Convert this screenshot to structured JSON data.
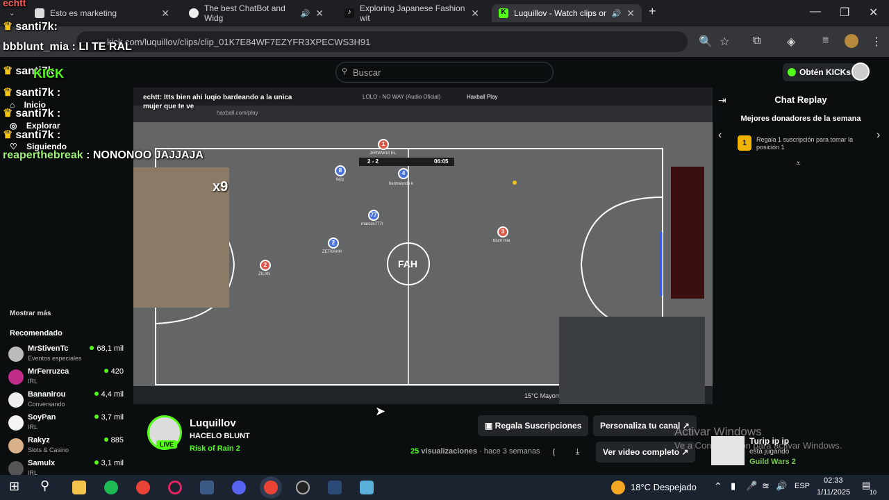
{
  "browser": {
    "tabs": [
      {
        "label": "Esto es marketing"
      },
      {
        "label": "The best ChatBot and Widg"
      },
      {
        "label": "Exploring Japanese Fashion wit"
      },
      {
        "label": "Luquillov - Watch clips on K"
      }
    ],
    "url": "kick.com/luquillov/clips/clip_01K7E84WF7EZYFR3XPECWS3H91"
  },
  "kick": {
    "search_placeholder": "Buscar",
    "get_kicks": "Obtén KICKs",
    "nav": [
      "Inicio",
      "Explorar",
      "Siguiendo"
    ],
    "show_more": "Mostrar más",
    "recommended_title": "Recomendado",
    "recommended": [
      {
        "name": "MrStivenTc",
        "category": "Eventos especiales",
        "viewers": "68,1 mil"
      },
      {
        "name": "MrFerruzca",
        "category": "IRL",
        "viewers": "420"
      },
      {
        "name": "Bananirou",
        "category": "Conversando",
        "viewers": "4,4 mil"
      },
      {
        "name": "SoyPan",
        "category": "IRL",
        "viewers": "3,7 mil"
      },
      {
        "name": "Rakyz",
        "category": "Slots & Casino",
        "viewers": "885"
      },
      {
        "name": "Samulx",
        "category": "IRL",
        "viewers": "3,1 mil"
      }
    ]
  },
  "overlay_chat": [
    {
      "user": "echtt",
      "text": ""
    },
    {
      "user": "santi7k",
      "text": ""
    },
    {
      "user": "bbblunt_mia",
      "text": "LI TE RAL"
    },
    {
      "user": "santi7k",
      "text": ""
    },
    {
      "user": "santi7k",
      "text": ""
    },
    {
      "user": "santi7k",
      "text": ""
    },
    {
      "user": "santi7k",
      "text": ""
    },
    {
      "user": "reaperthebreak",
      "text": "NONONOO JAJJAJA"
    }
  ],
  "overlay_extra": {
    "kick_logo": "KICK",
    "x9": "x9",
    "inner_chat": [
      "echtt: Itts bien ahi luqio bardeando a la unica",
      "mujer que te ve"
    ]
  },
  "game": {
    "inner_tabs": [
      "Haxball Play",
      "LOLO - NO WAY (Audio Oficial)"
    ],
    "inner_url": "haxball.com/play",
    "score": "2 - 2",
    "time": "06:05",
    "center_logo": "FAH",
    "players": [
      {
        "num": "8",
        "name": "felip"
      },
      {
        "num": "4",
        "name": "hermanode k"
      },
      {
        "num": "77",
        "name": "marcos777r"
      },
      {
        "num": "2",
        "name": "ZETKAHH"
      },
      {
        "num": "2",
        "name": "ZILAN"
      },
      {
        "num": "3",
        "name": "blunt mia"
      },
      {
        "num": "1",
        "name": "JERWW18 EL"
      }
    ],
    "weather_small": "15°C Mayorm"
  },
  "chat_panel": {
    "title": "Chat Replay",
    "donors_title": "Mejores donadores de la semana",
    "rank": "1",
    "gift_text": "Regala 1 suscripción para tomar la posición 1"
  },
  "channel": {
    "name": "Luquillov",
    "title": "HACELO BLUNT",
    "category": "Risk of Rain 2",
    "live": "LIVE",
    "gift_subs": "Regala Suscripciones",
    "customize": "Personaliza tu canal",
    "views_count": "25",
    "views_label": "visualizaciones",
    "age": "hace 3 semanas",
    "full_video": "Ver video completo"
  },
  "notification": {
    "name": "Turip ip ip",
    "status": "está jugando",
    "game": "Guild Wars 2"
  },
  "activate": {
    "line1": "Activar Windows",
    "line2": "Ve a Configuración para activar Windows."
  },
  "taskbar": {
    "weather": "18°C Despejado",
    "lang": "ESP",
    "time": "02:33",
    "date": "1/11/2025",
    "notif_count": "10"
  }
}
